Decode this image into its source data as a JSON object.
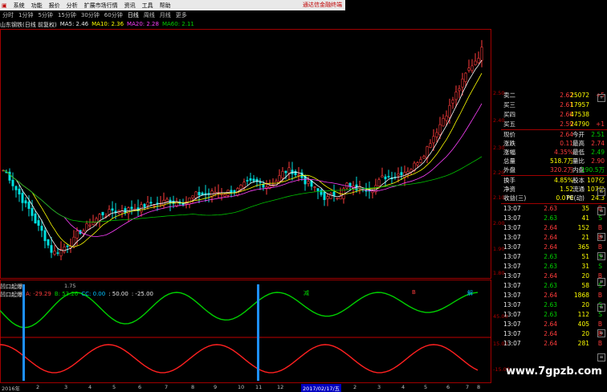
{
  "menu": {
    "items": [
      "系统",
      "功能",
      "报价",
      "分析",
      "扩展市场行情",
      "资讯",
      "工具",
      "帮助"
    ],
    "banner": "通达信金融终端"
  },
  "periods": [
    "分时",
    "1分钟",
    "5分钟",
    "15分钟",
    "30分钟",
    "60分钟",
    "日线",
    "周线",
    "月线",
    "更多"
  ],
  "main_info": {
    "stock": "山东钢铁(日线 前复权)",
    "ma5": "MA5: 2.46",
    "ma10": "MA10: 2.36",
    "ma20": "MA20: 2.28",
    "ma60": "MA60: 2.11"
  },
  "price_axis": [
    "2.50",
    "2.40",
    "2.30",
    "2.20",
    "2.10",
    "2.00",
    "1.90",
    "1.80"
  ],
  "low_label": "1.75",
  "sub_info": {
    "name": "凹口起爆",
    "a": "A: -29.29",
    "b": "B: 53.26",
    "cc": "CC: 0.00",
    "v50": ": 50.00",
    "vm25": ": -25.00"
  },
  "sub_axis": [
    "45.00",
    "15.00",
    "-15.00"
  ],
  "dates": [
    "2016年",
    "2",
    "3",
    "4",
    "5",
    "6",
    "7",
    "8",
    "9",
    "10",
    "11",
    "12",
    "2017/02/17/五",
    "2",
    "3",
    "4",
    "5",
    "6",
    "7",
    "8"
  ],
  "quote": {
    "asks": [
      {
        "label": "卖二",
        "price": "2.62",
        "vol": "25072",
        "chg": "+5"
      },
      {
        "label": "买三",
        "price": "2.61",
        "vol": "17957",
        "chg": ""
      },
      {
        "label": "买四",
        "price": "2.60",
        "vol": "47538",
        "chg": ""
      },
      {
        "label": "买五",
        "price": "2.59",
        "vol": "24790",
        "chg": "+1"
      }
    ],
    "stats": [
      {
        "l1": "现价",
        "v1": "2.64",
        "l2": "今开",
        "v2": "2.51"
      },
      {
        "l1": "涨跌",
        "v1": "0.11",
        "l2": "最高",
        "v2": "2.74"
      },
      {
        "l1": "涨幅",
        "v1": "4.35%",
        "l2": "最低",
        "v2": "2.49"
      },
      {
        "l1": "总量",
        "v1": "518.7万",
        "l2": "量比",
        "v2": "2.90"
      },
      {
        "l1": "外盘",
        "v1": "320.2万",
        "l2": "内盘",
        "v2": "190.5万"
      }
    ],
    "stats2": [
      {
        "l1": "换手",
        "v1": "4.85%",
        "l2": "股本",
        "v2": "107亿"
      },
      {
        "l1": "净资",
        "v1": "1.52",
        "l2": "流通",
        "v2": "107亿"
      },
      {
        "l1": "收益(三)",
        "v1": "0.070",
        "l2": "PE(动)",
        "v2": "24.3"
      }
    ],
    "ticks": [
      {
        "t": "13:07",
        "p": "2.63",
        "v": "35",
        "s": "B"
      },
      {
        "t": "13:07",
        "p": "2.63",
        "v": "41",
        "s": "S"
      },
      {
        "t": "13:07",
        "p": "2.64",
        "v": "152",
        "s": "B"
      },
      {
        "t": "13:07",
        "p": "2.64",
        "v": "21",
        "s": "B"
      },
      {
        "t": "13:07",
        "p": "2.64",
        "v": "365",
        "s": "B"
      },
      {
        "t": "13:07",
        "p": "2.63",
        "v": "51",
        "s": "S"
      },
      {
        "t": "13:07",
        "p": "2.63",
        "v": "31",
        "s": "S"
      },
      {
        "t": "13:07",
        "p": "2.64",
        "v": "20",
        "s": "B"
      },
      {
        "t": "13:07",
        "p": "2.63",
        "v": "58",
        "s": "S"
      },
      {
        "t": "13:07",
        "p": "2.64",
        "v": "1868",
        "s": "B"
      },
      {
        "t": "13:07",
        "p": "2.63",
        "v": "20",
        "s": "S"
      },
      {
        "t": "13:07",
        "p": "2.63",
        "v": "112",
        "s": "S"
      },
      {
        "t": "13:07",
        "p": "2.64",
        "v": "405",
        "s": "B"
      },
      {
        "t": "13:07",
        "p": "2.64",
        "v": "20",
        "s": "B"
      },
      {
        "t": "13:07",
        "p": "2.64",
        "v": "281",
        "s": "B"
      }
    ]
  },
  "watermark": "www.7gpzb.com",
  "markers": [
    "减",
    "B",
    "解"
  ]
}
